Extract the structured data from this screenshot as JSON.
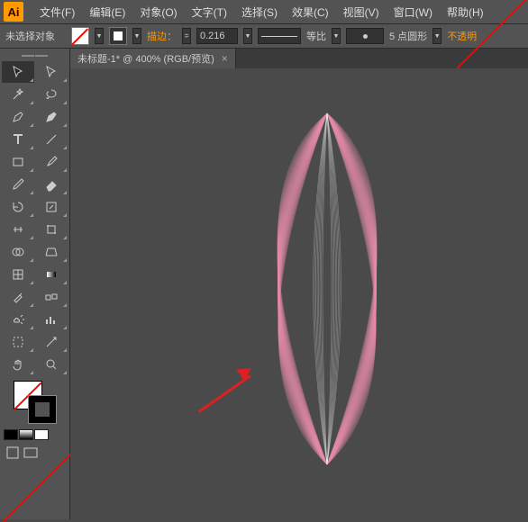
{
  "menubar": {
    "items": [
      "文件(F)",
      "编辑(E)",
      "对象(O)",
      "文字(T)",
      "选择(S)",
      "效果(C)",
      "视图(V)",
      "窗口(W)",
      "帮助(H)"
    ]
  },
  "optbar": {
    "status": "未选择对象",
    "stroke_label": "描边：",
    "stroke_value": "0.216",
    "scale_label": "等比",
    "round_label": "5 点圆形",
    "opacity_label": "不透明"
  },
  "doctab": {
    "title": "未标题-1* @ 400% (RGB/预览)"
  },
  "tools": {
    "names": [
      "selection-tool",
      "direct-selection-tool",
      "magic-wand-tool",
      "lasso-tool",
      "pen-tool",
      "curvature-tool",
      "type-tool",
      "line-segment-tool",
      "rectangle-tool",
      "paintbrush-tool",
      "pencil-tool",
      "eraser-tool",
      "rotate-tool",
      "scale-tool",
      "width-tool",
      "free-transform-tool",
      "shape-builder-tool",
      "perspective-grid-tool",
      "mesh-tool",
      "gradient-tool",
      "eyedropper-tool",
      "blend-tool",
      "symbol-sprayer-tool",
      "column-graph-tool",
      "artboard-tool",
      "slice-tool",
      "hand-tool",
      "zoom-tool"
    ]
  },
  "mini_swatches": [
    "#000000",
    "#ffffff",
    "#ff0000"
  ],
  "logo": "Ai"
}
